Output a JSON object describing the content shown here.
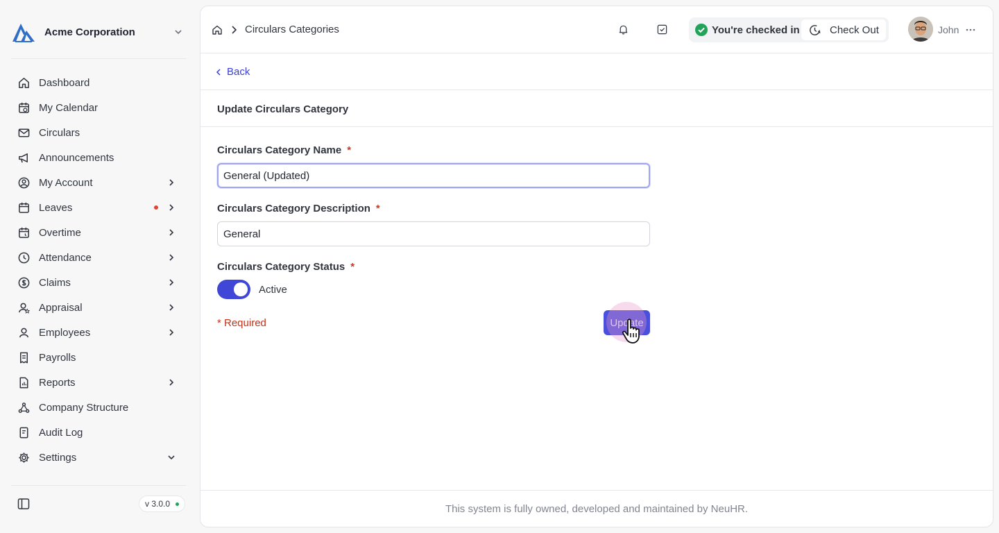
{
  "org": {
    "name": "Acme Corporation"
  },
  "sidebar": {
    "items": [
      {
        "label": "Dashboard",
        "icon": "home-icon",
        "chevron": ""
      },
      {
        "label": "My Calendar",
        "icon": "calendar-icon",
        "chevron": ""
      },
      {
        "label": "Circulars",
        "icon": "mail-icon",
        "chevron": ""
      },
      {
        "label": "Announcements",
        "icon": "megaphone-icon",
        "chevron": ""
      },
      {
        "label": "My Account",
        "icon": "user-circle-icon",
        "chevron": "right"
      },
      {
        "label": "Leaves",
        "icon": "calendar-check-icon",
        "chevron": "right",
        "badge_dot": true
      },
      {
        "label": "Overtime",
        "icon": "calendar-clock-icon",
        "chevron": "right"
      },
      {
        "label": "Attendance",
        "icon": "clock-icon",
        "chevron": "right"
      },
      {
        "label": "Claims",
        "icon": "dollar-circle-icon",
        "chevron": "right"
      },
      {
        "label": "Appraisal",
        "icon": "user-star-icon",
        "chevron": "right"
      },
      {
        "label": "Employees",
        "icon": "user-icon",
        "chevron": "right"
      },
      {
        "label": "Payrolls",
        "icon": "receipt-icon",
        "chevron": ""
      },
      {
        "label": "Reports",
        "icon": "report-icon",
        "chevron": "right"
      },
      {
        "label": "Company Structure",
        "icon": "network-icon",
        "chevron": ""
      },
      {
        "label": "Audit Log",
        "icon": "audit-icon",
        "chevron": ""
      },
      {
        "label": "Settings",
        "icon": "gear-icon",
        "chevron": "down"
      }
    ],
    "version": "v 3.0.0"
  },
  "header": {
    "breadcrumb": "Circulars Categories",
    "checkin_status": "You're checked in",
    "checkout_label": "Check Out",
    "user_name": "John"
  },
  "page": {
    "back_label": "Back",
    "title": "Update Circulars Category",
    "fields": {
      "name": {
        "label": "Circulars Category Name",
        "required": "*",
        "value": "General (Updated)"
      },
      "description": {
        "label": "Circulars Category Description",
        "required": "*",
        "value": "General"
      },
      "status": {
        "label": "Circulars Category Status",
        "required": "*",
        "value": "Active",
        "enabled": true
      }
    },
    "required_note": "* Required",
    "update_label": "Update"
  },
  "footer": {
    "text": "This system is fully owned, developed and maintained by NeuHR."
  },
  "colors": {
    "accent": "#4046d6",
    "success": "#22a35a",
    "required": "#c4321a"
  }
}
